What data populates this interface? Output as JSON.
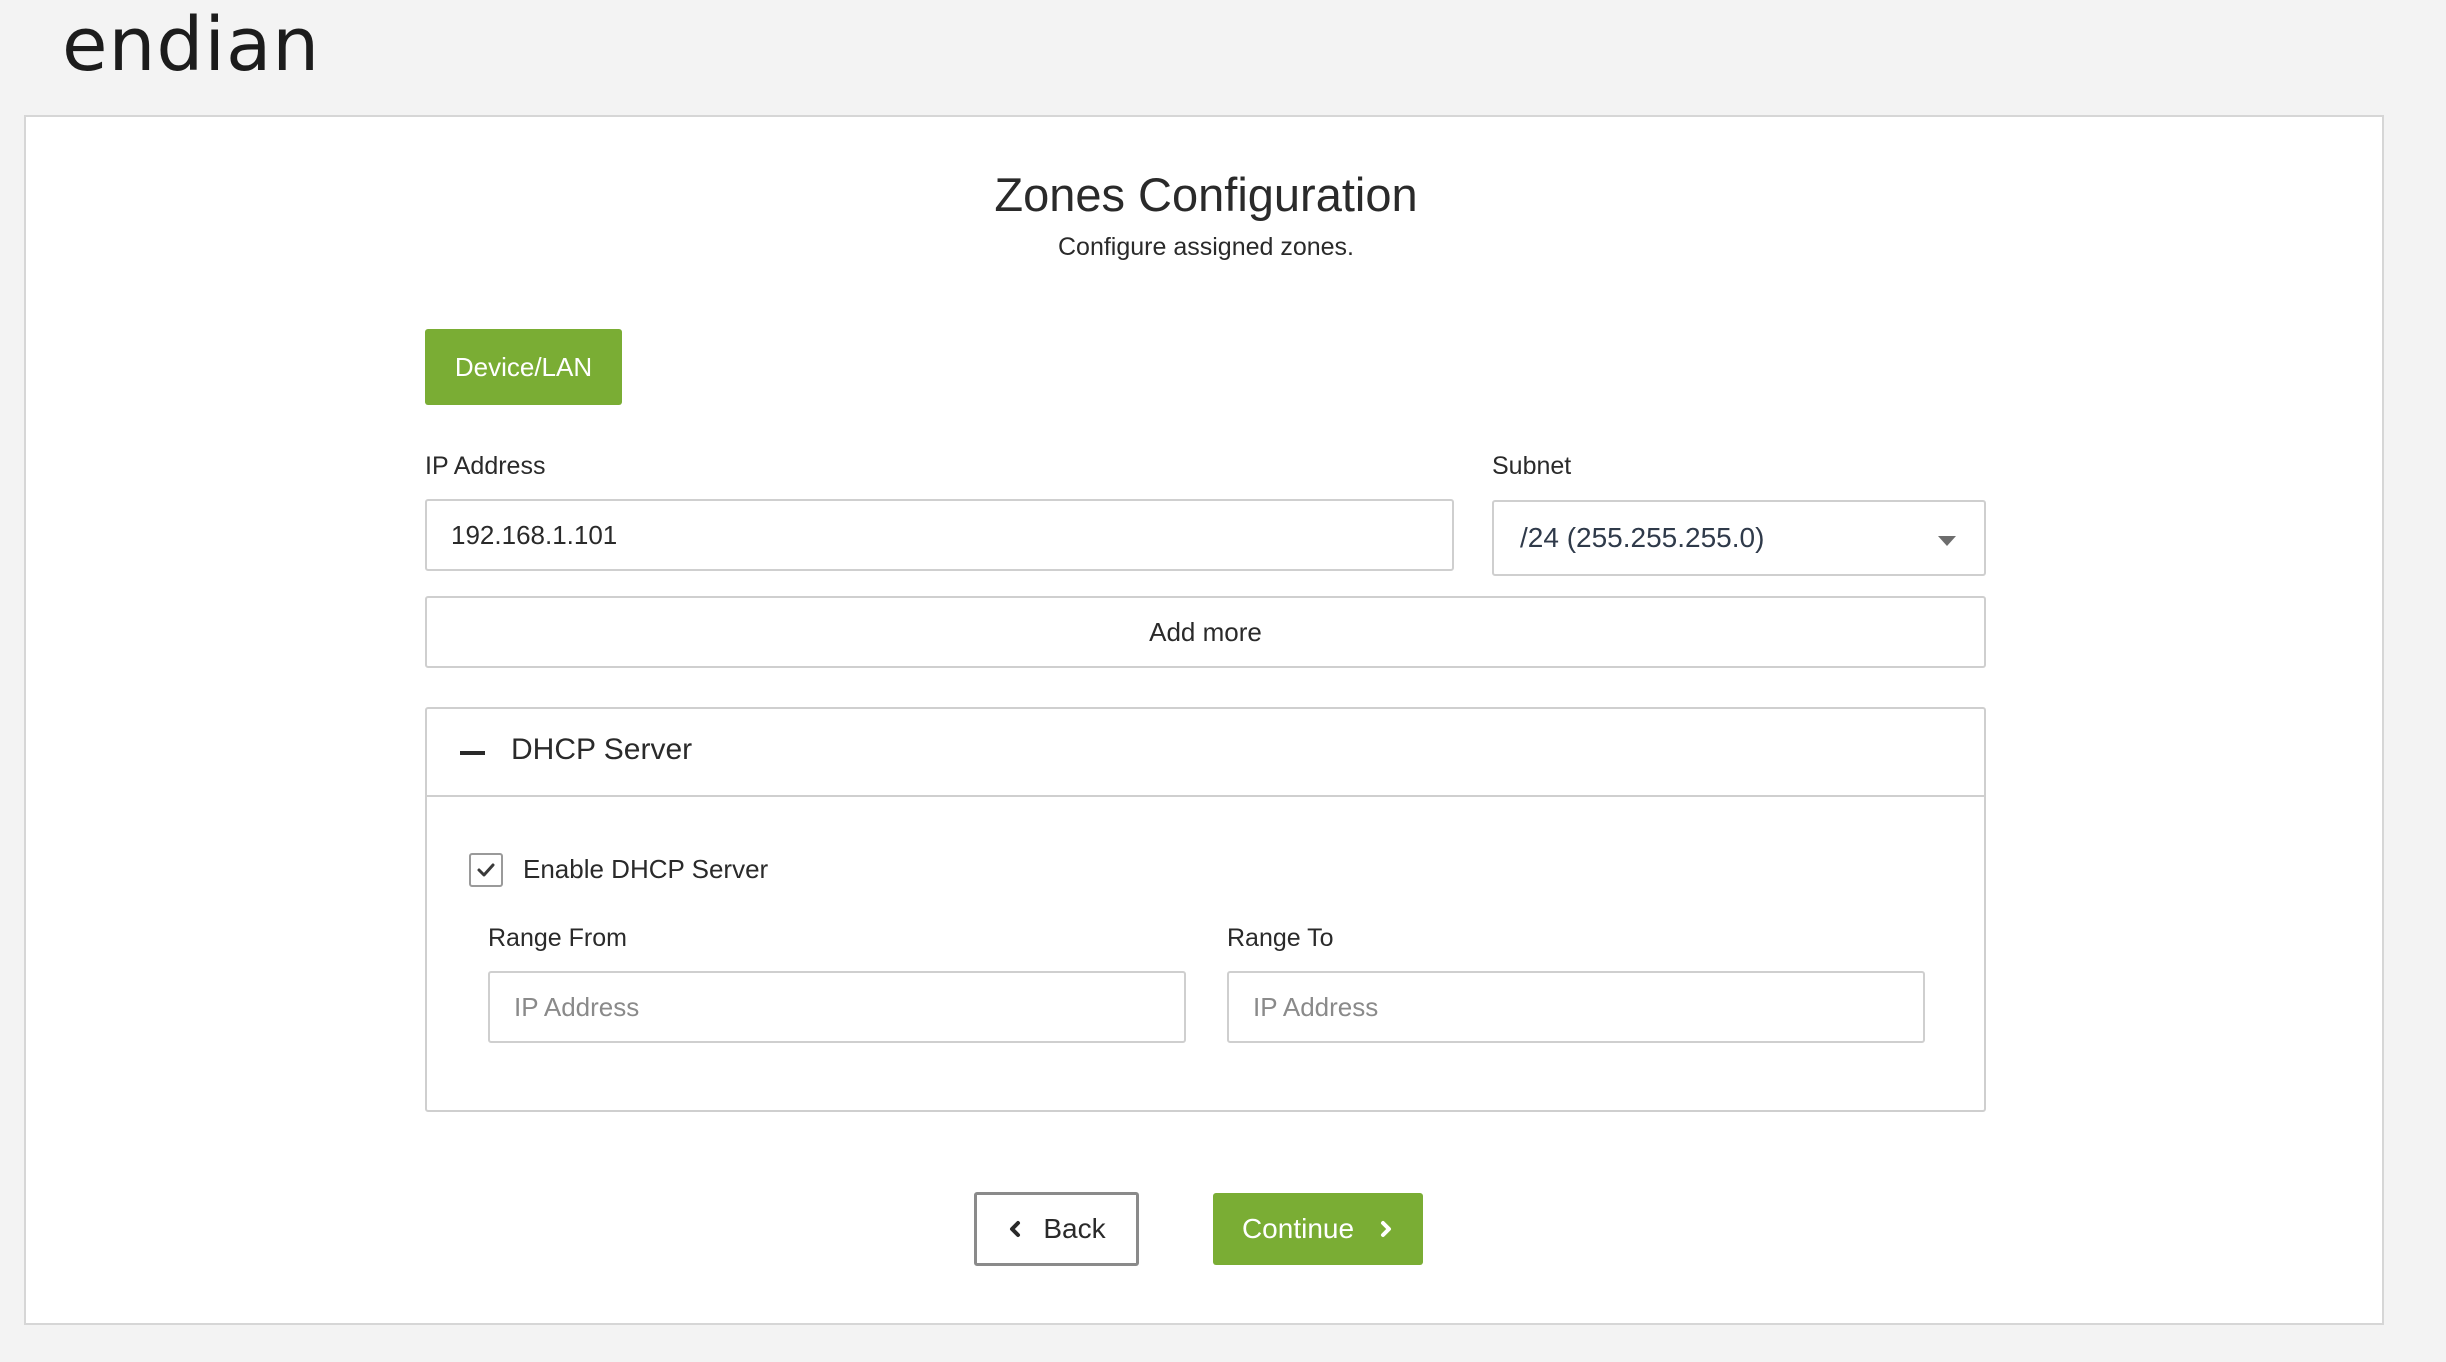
{
  "header": {
    "logo_text": "endian"
  },
  "page": {
    "title": "Zones Configuration",
    "subtitle": "Configure assigned zones."
  },
  "zone_tab": {
    "label": "Device/LAN",
    "color": "#7aad34"
  },
  "ip_address": {
    "label": "IP Address",
    "value": "192.168.1.101"
  },
  "subnet": {
    "label": "Subnet",
    "selected": "/24 (255.255.255.0)"
  },
  "add_more": {
    "label": "Add more"
  },
  "dhcp": {
    "section_title": "DHCP Server",
    "enable_label": "Enable DHCP Server",
    "enabled": true,
    "range_from": {
      "label": "Range From",
      "placeholder": "IP Address",
      "value": ""
    },
    "range_to": {
      "label": "Range To",
      "placeholder": "IP Address",
      "value": ""
    }
  },
  "footer": {
    "back_label": "Back",
    "continue_label": "Continue"
  },
  "icons": {
    "collapse": "minus-icon",
    "checkbox": "check-icon",
    "subnet_dropdown": "caret-down-icon",
    "back": "chevron-left-icon",
    "continue": "chevron-right-icon"
  }
}
